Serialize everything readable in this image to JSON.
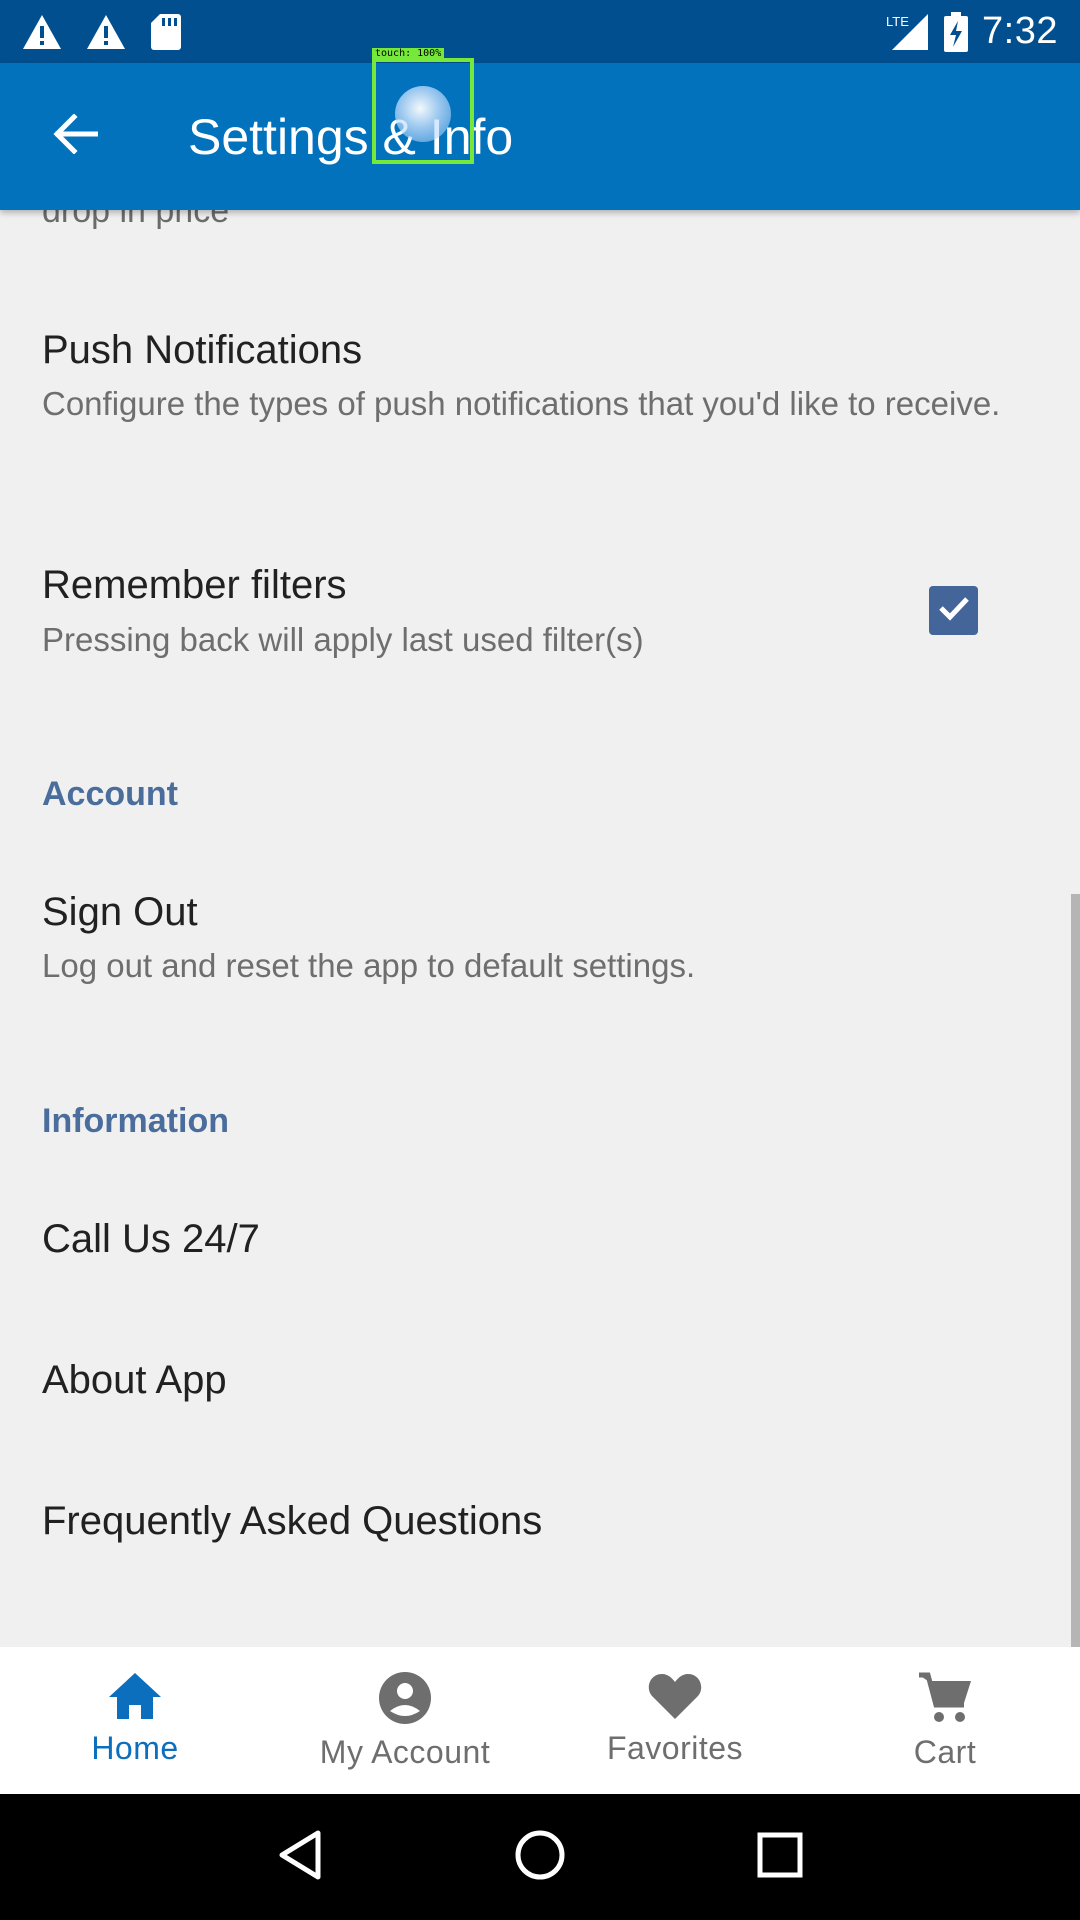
{
  "status_bar": {
    "time": "7:32",
    "network": "LTE",
    "icons": [
      "warning-icon",
      "warning-icon",
      "sd-card-icon",
      "signal-icon",
      "battery-charging-icon"
    ]
  },
  "app_bar": {
    "title": "Settings & Info",
    "back_icon": "arrow-back-icon"
  },
  "touch_overlay": {
    "label": "touch: 100%"
  },
  "content": {
    "partial_text": "drop in price",
    "push_notifications": {
      "title": "Push Notifications",
      "summary": "Configure the types of push notifications that you'd like to receive."
    },
    "remember_filters": {
      "title": "Remember filters",
      "summary": "Pressing back will apply last used filter(s)",
      "checked": true
    },
    "account_header": "Account",
    "sign_out": {
      "title": "Sign Out",
      "summary": "Log out and reset the app to default settings."
    },
    "information_header": "Information",
    "call_us": "Call Us 24/7",
    "about_app": "About App",
    "faq": "Frequently Asked Questions"
  },
  "bottom_nav": {
    "items": [
      {
        "label": "Home",
        "icon": "home-icon",
        "active": true
      },
      {
        "label": "My Account",
        "icon": "account-circle-icon",
        "active": false
      },
      {
        "label": "Favorites",
        "icon": "heart-icon",
        "active": false
      },
      {
        "label": "Cart",
        "icon": "cart-icon",
        "active": false
      }
    ]
  },
  "colors": {
    "status_bar": "#014f8f",
    "app_bar": "#0272bd",
    "accent": "#0b6fbd",
    "section_header": "#4a6d9c",
    "checkbox": "#44659a",
    "touch_box": "#76e83a"
  }
}
